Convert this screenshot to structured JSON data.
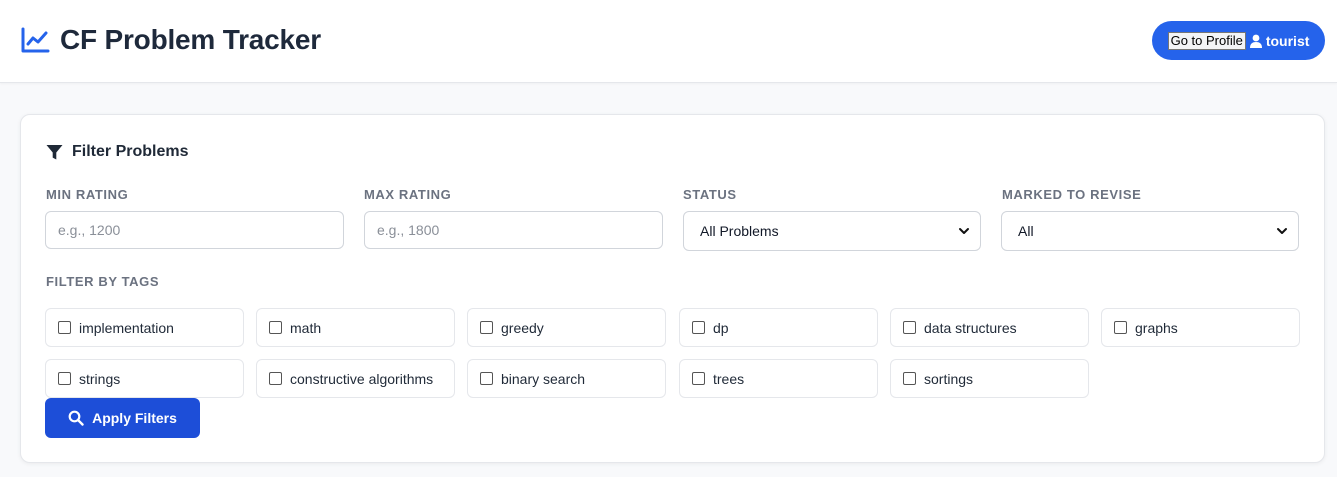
{
  "header": {
    "title": "CF Problem Tracker",
    "brand_icon": "chart-line-icon",
    "profile_button": {
      "label": "Go to Profile",
      "username": "tourist",
      "icon": "user-icon"
    }
  },
  "filters": {
    "title": "Filter Problems",
    "icon": "filter-icon",
    "min_rating": {
      "label": "MIN RATING",
      "placeholder": "e.g., 1200",
      "value": ""
    },
    "max_rating": {
      "label": "MAX RATING",
      "placeholder": "e.g., 1800",
      "value": ""
    },
    "status": {
      "label": "STATUS",
      "selected": "All Problems"
    },
    "revise": {
      "label": "MARKED TO REVISE",
      "selected": "All"
    },
    "tags_label": "FILTER BY TAGS",
    "tags": [
      {
        "label": "implementation",
        "checked": false
      },
      {
        "label": "math",
        "checked": false
      },
      {
        "label": "greedy",
        "checked": false
      },
      {
        "label": "dp",
        "checked": false
      },
      {
        "label": "data structures",
        "checked": false
      },
      {
        "label": "graphs",
        "checked": false
      },
      {
        "label": "strings",
        "checked": false
      },
      {
        "label": "constructive algorithms",
        "checked": false
      },
      {
        "label": "binary search",
        "checked": false
      },
      {
        "label": "trees",
        "checked": false
      },
      {
        "label": "sortings",
        "checked": false
      }
    ],
    "apply_label": "Apply Filters"
  },
  "colors": {
    "accent": "#2563eb",
    "button": "#1d4ed8",
    "background": "#f8f9fb"
  }
}
